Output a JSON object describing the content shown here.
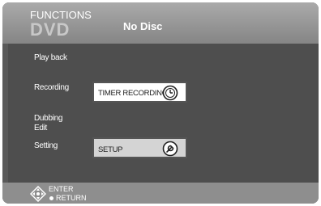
{
  "header": {
    "title": "FUNCTIONS",
    "disc_type": "DVD",
    "disc_status": "No Disc"
  },
  "menu": {
    "playback_label": "Play back",
    "recording_label": "Recording",
    "timer_button_label": "TIMER RECORDING",
    "dubbing_label": "Dubbing",
    "edit_label": "Edit",
    "setting_label": "Setting",
    "setup_button_label": "SETUP"
  },
  "footer": {
    "enter_label": "ENTER",
    "return_label": "RETURN"
  },
  "colors": {
    "panel": "#5a5a5a",
    "header": "#9a9a9a",
    "text": "#ffffff"
  }
}
